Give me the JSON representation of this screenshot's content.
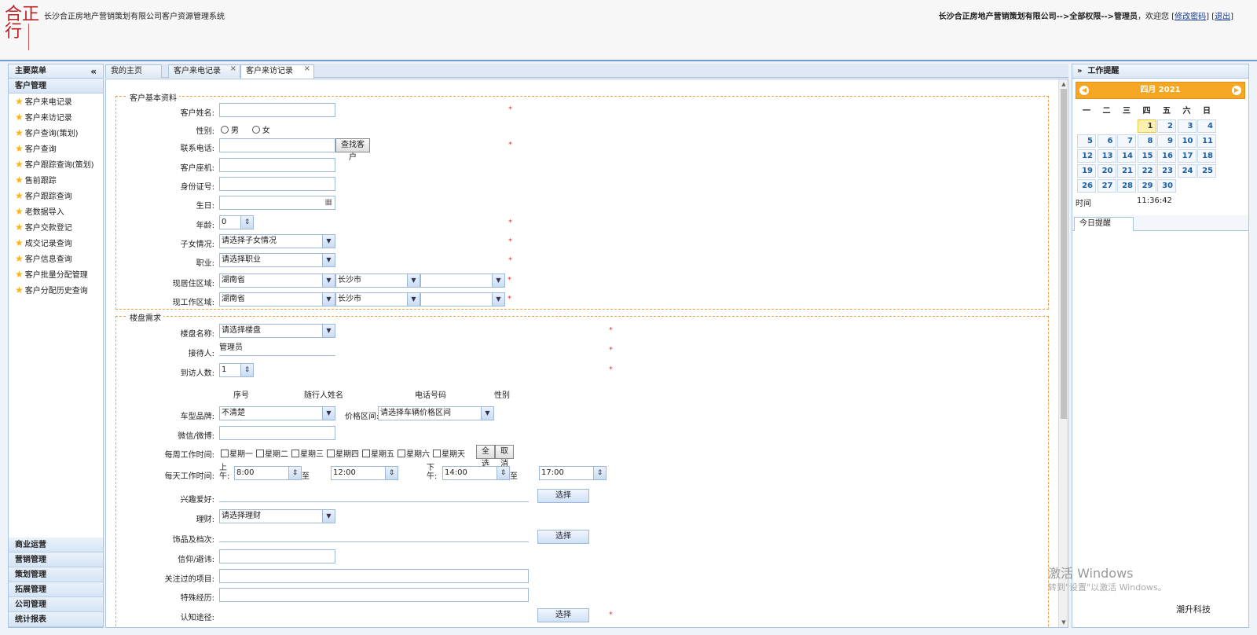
{
  "header": {
    "logo_text": "合正行",
    "system_title": "长沙合正房地产营销策划有限公司客户资源管理系统",
    "company_path": "长沙合正房地产营销策划有限公司-->全部权限-->管理员",
    "welcome": "，欢迎您",
    "change_pwd": "修改密码",
    "logout": "退出"
  },
  "sidebar": {
    "title": "主要菜单",
    "collapse_icon": "«",
    "group": "客户管理",
    "items": [
      "客户来电记录",
      "客户来访记录",
      "客户查询(策划)",
      "客户查询",
      "客户跟踪查询(策划)",
      "售前跟踪",
      "客户跟踪查询",
      "老数据导入",
      "客户交款登记",
      "成交记录查询",
      "客户信息查询",
      "客户批量分配管理",
      "客户分配历史查询"
    ],
    "bottom_groups": [
      "商业运营",
      "营销管理",
      "策划管理",
      "拓展管理",
      "公司管理",
      "统计报表"
    ]
  },
  "tabs": [
    {
      "label": "我的主页",
      "closable": false
    },
    {
      "label": "客户来电记录",
      "closable": true
    },
    {
      "label": "客户来访记录",
      "closable": true,
      "active": true
    }
  ],
  "form": {
    "basic_legend": "客户基本资料",
    "name_label": "客户姓名:",
    "gender_label": "性别:",
    "gender_male": "男",
    "gender_female": "女",
    "phone_label": "联系电话:",
    "find_customer": "查找客户",
    "landline_label": "客户座机:",
    "id_label": "身份证号:",
    "birthday_label": "生日:",
    "age_label": "年龄:",
    "age_value": "0",
    "children_label": "子女情况:",
    "children_value": "请选择子女情况",
    "job_label": "职业:",
    "job_value": "请选择职业",
    "home_area_label": "现居住区域:",
    "work_area_label": "现工作区域:",
    "province": "湖南省",
    "city": "长沙市",
    "district": "",
    "required_mark": "*",
    "req_legend": "楼盘需求",
    "project_label": "楼盘名称:",
    "project_value": "请选择楼盘",
    "receiver_label": "接待人:",
    "receiver_value": "管理员",
    "visitors_label": "到访人数:",
    "visitors_value": "1",
    "col_no": "序号",
    "col_companion": "随行人姓名",
    "col_phone": "电话号码",
    "col_gender": "性别",
    "car_label": "车型品牌:",
    "car_value": "不清楚",
    "price_label": "价格区间:",
    "price_value": "请选择车辆价格区间",
    "wechat_label": "微信/微博:",
    "weekly_label": "每周工作时间:",
    "weekdays": [
      "星期一",
      "星期二",
      "星期三",
      "星期四",
      "星期五",
      "星期六",
      "星期天"
    ],
    "select_all": "全选",
    "cancel": "取消",
    "daily_label": "每天工作时间:",
    "am_label": "上午:",
    "pm_label": "下午:",
    "to": "至",
    "am_start": "8:00",
    "am_end": "12:00",
    "pm_start": "14:00",
    "pm_end": "17:00",
    "hobby_label": "兴趣爱好:",
    "choose": "选择",
    "finance_label": "理财:",
    "finance_value": "请选择理财",
    "jewelry_label": "饰品及档次:",
    "belief_label": "信仰/避讳:",
    "followed_label": "关注过的项目:",
    "experience_label": "特殊经历:",
    "cognition_label": "认知途径:"
  },
  "right_panel": {
    "title": "工作提醒",
    "expand_icon": "»",
    "calendar_title": "四月 2021",
    "weekdays": [
      "一",
      "二",
      "三",
      "四",
      "五",
      "六",
      "日"
    ],
    "days": [
      "1",
      "2",
      "3",
      "4",
      "5",
      "6",
      "7",
      "8",
      "9",
      "10",
      "11",
      "12",
      "13",
      "14",
      "15",
      "16",
      "17",
      "18",
      "19",
      "20",
      "21",
      "22",
      "23",
      "24",
      "25",
      "26",
      "27",
      "28",
      "29",
      "30"
    ],
    "today": "1",
    "time_label": "时间",
    "time_value": "11:36:42",
    "today_tab": "今日提醒"
  },
  "overlay": {
    "activate_title": "激活 Windows",
    "activate_hint": "转到\"设置\"以激活 Windows。",
    "brand": "潮升科技"
  }
}
